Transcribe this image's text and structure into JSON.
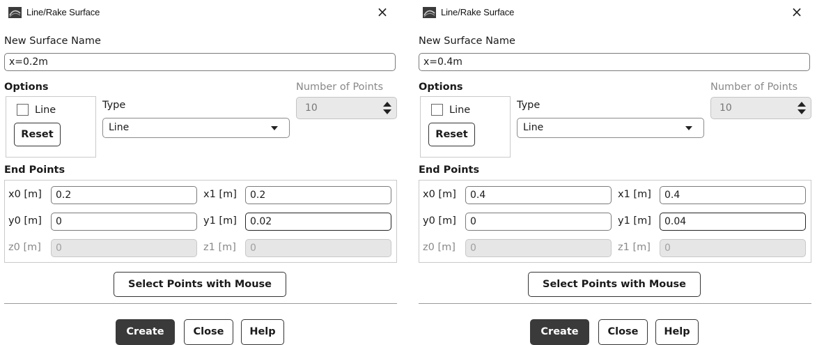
{
  "dialogs": [
    {
      "title": "Line/Rake Surface",
      "close_glyph": "×",
      "icon": "app-mesh-icon",
      "new_surface_name_label": "New Surface Name",
      "new_surface_name_value": "x=0.2m",
      "options_label": "Options",
      "line_checkbox_label": "Line",
      "line_checked": false,
      "reset_label": "Reset",
      "type_label": "Type",
      "type_value": "Line",
      "number_of_points_label": "Number of Points",
      "number_of_points_value": "10",
      "end_points_label": "End Points",
      "x0_label": "x0 [m]",
      "x0_value": "0.2",
      "x1_label": "x1 [m]",
      "x1_value": "0.2",
      "y0_label": "y0 [m]",
      "y0_value": "0",
      "y1_label": "y1 [m]",
      "y1_value": "0.02",
      "z0_label": "z0 [m]",
      "z0_value": "0",
      "z1_label": "z1 [m]",
      "z1_value": "0",
      "select_points_label": "Select Points with Mouse",
      "create_label": "Create",
      "close_label": "Close",
      "help_label": "Help"
    },
    {
      "title": "Line/Rake Surface",
      "close_glyph": "×",
      "icon": "app-mesh-icon",
      "new_surface_name_label": "New Surface Name",
      "new_surface_name_value": "x=0.4m",
      "options_label": "Options",
      "line_checkbox_label": "Line",
      "line_checked": false,
      "reset_label": "Reset",
      "type_label": "Type",
      "type_value": "Line",
      "number_of_points_label": "Number of Points",
      "number_of_points_value": "10",
      "end_points_label": "End Points",
      "x0_label": "x0 [m]",
      "x0_value": "0.4",
      "x1_label": "x1 [m]",
      "x1_value": "0.4",
      "y0_label": "y0 [m]",
      "y0_value": "0",
      "y1_label": "y1 [m]",
      "y1_value": "0.04",
      "z0_label": "z0 [m]",
      "z0_value": "0",
      "z1_label": "z1 [m]",
      "z1_value": "0",
      "select_points_label": "Select Points with Mouse",
      "create_label": "Create",
      "close_label": "Close",
      "help_label": "Help"
    }
  ],
  "colors": {
    "primary_button": "#3a3a3a",
    "disabled_field": "#e6e6e6",
    "group_border": "#c9c9c9"
  }
}
